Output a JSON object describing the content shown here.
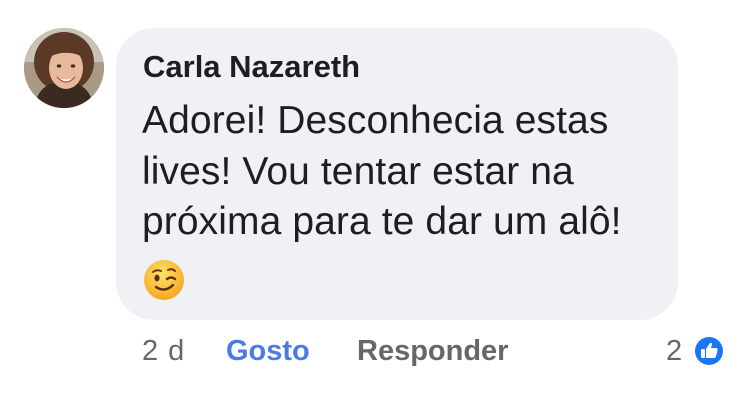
{
  "comment": {
    "author": "Carla Nazareth",
    "text_lines": [
      "Adorei! Desconhecia estas",
      "lives! Vou tentar estar na",
      "próxima para te dar um alô!"
    ],
    "emoji": "winking-face-emoji"
  },
  "actions": {
    "timestamp": "2 d",
    "like_label": "Gosto",
    "reply_label": "Responder"
  },
  "reactions": {
    "count": "2",
    "icon": "thumbs-up-icon",
    "badge_color": "#1877f2"
  },
  "colors": {
    "bubble": "#f0f1f4",
    "like_link": "#4a7be5",
    "secondary_text": "#65676b",
    "primary_text": "#1c1e21"
  }
}
